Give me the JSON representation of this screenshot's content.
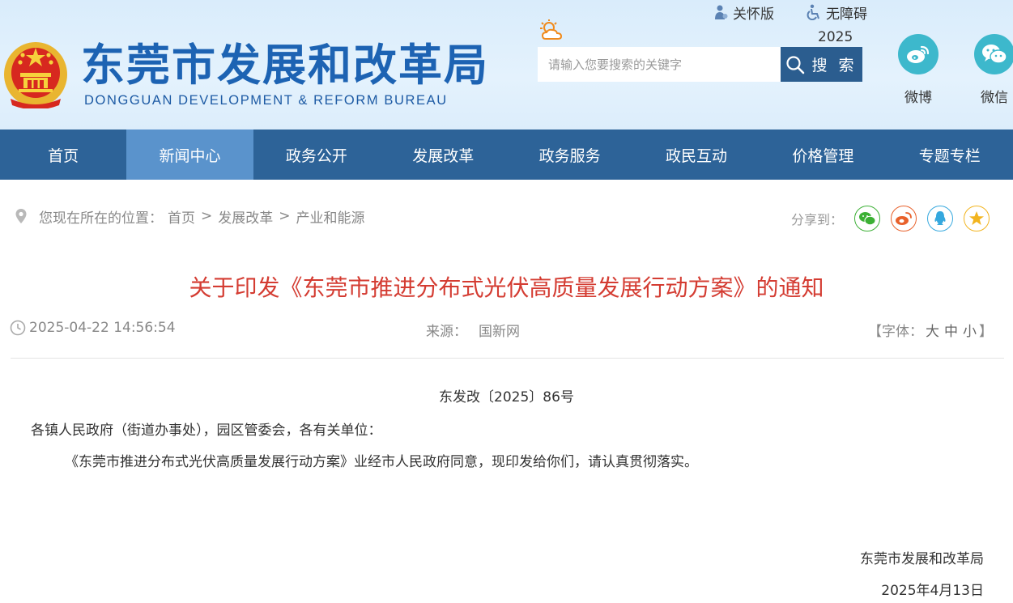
{
  "header": {
    "site_title": "东莞市发展和改革局",
    "site_subtitle": "DONGGUAN DEVELOPMENT & REFORM BUREAU",
    "care_label": "关怀版",
    "accessibility_label": "无障碍",
    "year_text": "2025",
    "search": {
      "placeholder": "请输入您要搜索的关键字",
      "button_label": "搜 索"
    },
    "social": [
      {
        "label": "微博"
      },
      {
        "label": "微信"
      }
    ]
  },
  "nav": {
    "items": [
      {
        "label": "首页"
      },
      {
        "label": "新闻中心"
      },
      {
        "label": "政务公开"
      },
      {
        "label": "发展改革"
      },
      {
        "label": "政务服务"
      },
      {
        "label": "政民互动"
      },
      {
        "label": "价格管理"
      },
      {
        "label": "专题专栏"
      }
    ],
    "active_index": 1,
    "bar_color": "#2d6398",
    "active_color": "#5a93cc"
  },
  "breadcrumb": {
    "prefix": "您现在所在的位置：",
    "items": [
      {
        "label": "首页"
      },
      {
        "label": "发展改革"
      },
      {
        "label": "产业和能源"
      }
    ],
    "separator": ">"
  },
  "share": {
    "label": "分享到：",
    "targets": [
      "wechat-icon",
      "weibo-icon",
      "qq-icon",
      "qzone-icon"
    ]
  },
  "article": {
    "title": "关于印发《东莞市推进分布式光伏高质量发展行动方案》的通知",
    "title_color": "#d43c32",
    "date": "2025-04-22 14:56:54",
    "source_label": "来源：",
    "source_value": "国新网",
    "font_size": {
      "prefix": "【字体：",
      "large": "大",
      "medium": "中",
      "small": "小",
      "suffix": "】"
    },
    "doc_number": "东发改〔2025〕86号",
    "salutation": "各镇人民政府（街道办事处），园区管委会，各有关单位：",
    "body": "《东莞市推进分布式光伏高质量发展行动方案》业经市人民政府同意，现印发给你们，请认真贯彻落实。",
    "signature": "东莞市发展和改革局",
    "sign_date": "2025年4月13日"
  }
}
